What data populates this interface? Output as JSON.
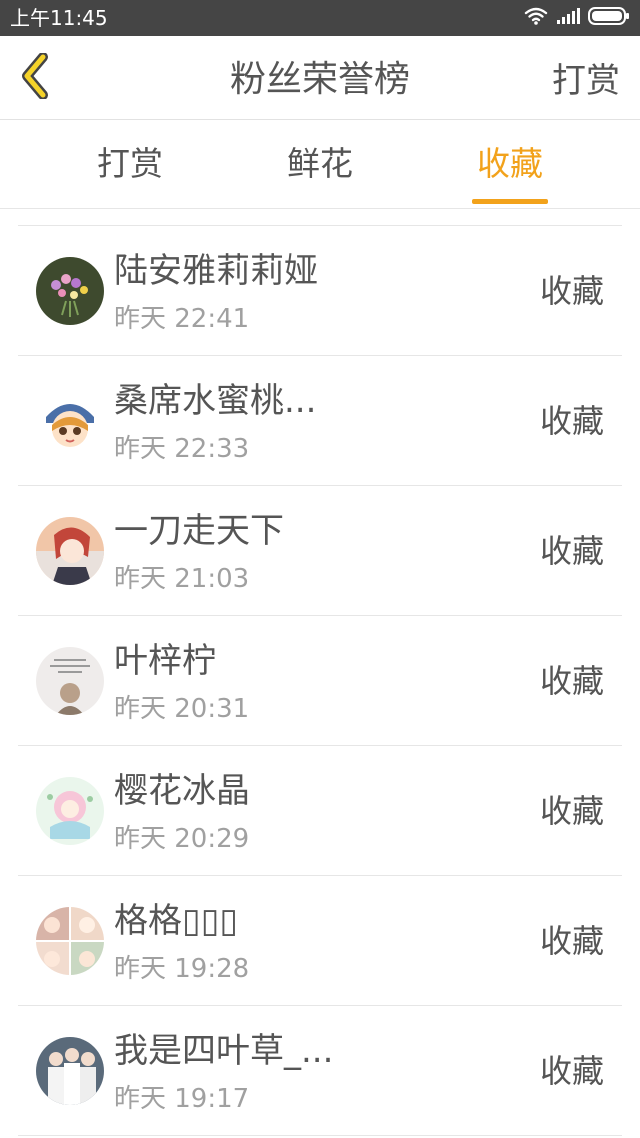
{
  "status_bar": {
    "time": "上午11:45",
    "icons": [
      "wifi-icon",
      "signal-icon",
      "battery-icon"
    ]
  },
  "nav": {
    "back_icon": "chevron-left-icon",
    "title": "粉丝荣誉榜",
    "action": "打赏"
  },
  "tabs": [
    {
      "label": "打赏",
      "active": false
    },
    {
      "label": "鲜花",
      "active": false
    },
    {
      "label": "收藏",
      "active": true
    }
  ],
  "colors": {
    "accent": "#f2a21b",
    "status_bar": "#454545",
    "text": "#555555",
    "secondary_text": "#a0a0a0",
    "divider": "#e6e6e6"
  },
  "fans": [
    {
      "name": "陆安雅莉莉娅",
      "time": "昨天 22:41",
      "type": "收藏"
    },
    {
      "name": "桑席水蜜桃...",
      "time": "昨天 22:33",
      "type": "收藏"
    },
    {
      "name": "一刀走天下",
      "time": "昨天 21:03",
      "type": "收藏"
    },
    {
      "name": "叶梓柠",
      "time": "昨天 20:31",
      "type": "收藏"
    },
    {
      "name": "樱花冰晶",
      "time": "昨天 20:29",
      "type": "收藏"
    },
    {
      "name": "格格▯▯▯",
      "time": "昨天 19:28",
      "type": "收藏"
    },
    {
      "name": "我是四叶草_...",
      "time": "昨天 19:17",
      "type": "收藏"
    }
  ]
}
